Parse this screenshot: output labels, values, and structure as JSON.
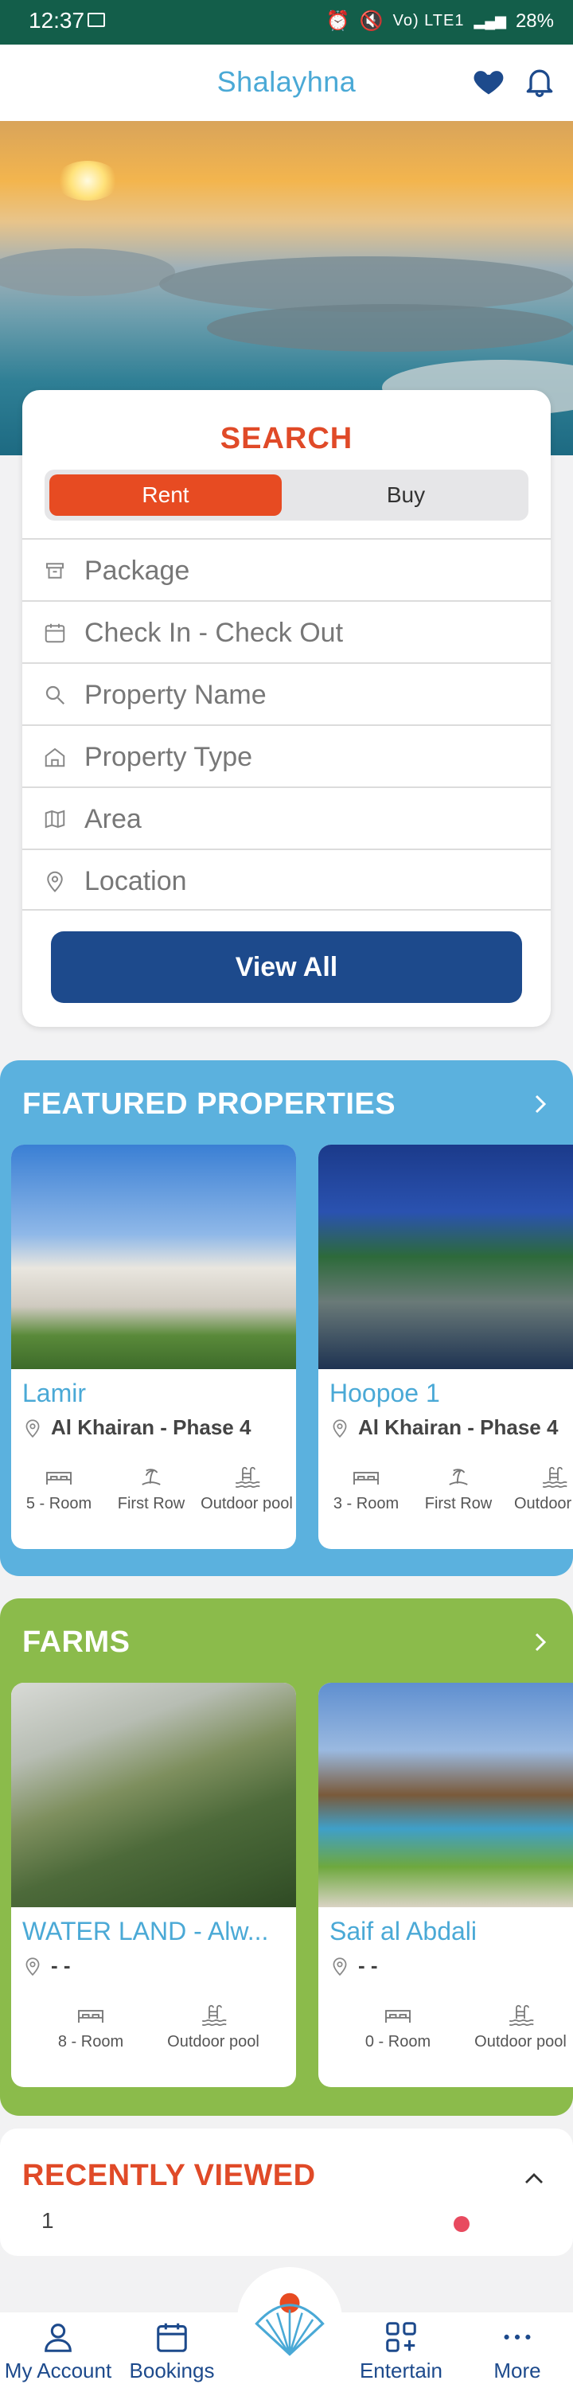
{
  "status_bar": {
    "time": "12:37",
    "network": "Vo) LTE1",
    "battery": "28%"
  },
  "app_bar": {
    "title": "Shalayhna",
    "icons": [
      "heart-icon",
      "bell-icon"
    ]
  },
  "colors": {
    "primary": "#1d4a8c",
    "accent": "#e74b22",
    "brand_blue": "#4aa9d6",
    "featured_bg": "#5bb1de",
    "farms_bg": "#8bbb4b",
    "status_bar": "#135e4a"
  },
  "search": {
    "title": "SEARCH",
    "tabs": [
      {
        "label": "Rent",
        "selected": true
      },
      {
        "label": "Buy",
        "selected": false
      }
    ],
    "fields": [
      {
        "placeholder": "Package",
        "icon": "package-icon"
      },
      {
        "placeholder": "Check In - Check Out",
        "icon": "calendar-icon"
      },
      {
        "placeholder": "Property Name",
        "icon": "search-icon"
      },
      {
        "placeholder": "Property Type",
        "icon": "home-icon"
      },
      {
        "placeholder": "Area",
        "icon": "map-icon"
      },
      {
        "placeholder": "Location",
        "icon": "location-pin-icon"
      }
    ],
    "view_all": "View All"
  },
  "featured": {
    "title": "FEATURED PROPERTIES",
    "cards": [
      {
        "name": "Lamir",
        "location": "Al Khairan - Phase 4",
        "features": [
          "5 - Room",
          "First Row",
          "Outdoor pool"
        ]
      },
      {
        "name": "Hoopoe 1",
        "location": "Al Khairan - Phase 4",
        "features": [
          "3 - Room",
          "First Row",
          "Outdoor po"
        ]
      }
    ]
  },
  "farms": {
    "title": "FARMS",
    "cards": [
      {
        "name": "WATER LAND - Alw...",
        "location": "- -",
        "features": [
          "8 - Room",
          "Outdoor pool"
        ]
      },
      {
        "name": "Saif al Abdali",
        "location": "- -",
        "features": [
          "0 - Room",
          "Outdoor pool"
        ]
      }
    ]
  },
  "recent": {
    "title": "RECENTLY VIEWED",
    "count": "1"
  },
  "bottom_nav": {
    "items": [
      {
        "label": "My Account",
        "icon": "user-icon"
      },
      {
        "label": "Bookings",
        "icon": "calendar-icon"
      },
      {
        "label": "Entertain",
        "icon": "grid-plus-icon"
      },
      {
        "label": "More",
        "icon": "more-dots-icon"
      }
    ],
    "center_icon": "shell-logo-icon"
  }
}
